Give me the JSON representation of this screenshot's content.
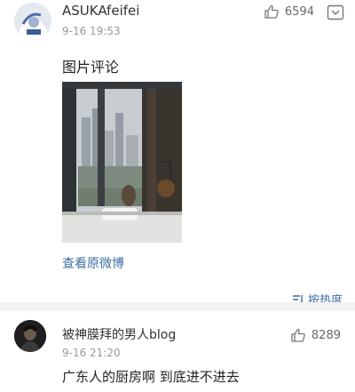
{
  "comments": [
    {
      "username": "ASUKAfeifei",
      "time": "9-16 19:53",
      "likes": "6594",
      "text": "图片评论",
      "view_original": "查看原微博"
    },
    {
      "username": "被神膜拜的男人blog",
      "time": "9-16 21:20",
      "likes": "8289",
      "text": "广东人的厨房啊  到底进不进去"
    }
  ],
  "sort": {
    "label": "按热度"
  },
  "colors": {
    "link": "#3d6ea6",
    "secondary_text": "#999999",
    "divider": "#f2f2f2"
  },
  "icons": {
    "like": "thumbs-up-icon",
    "more": "dropdown-more-icon",
    "sort": "sort-lines-icon"
  }
}
